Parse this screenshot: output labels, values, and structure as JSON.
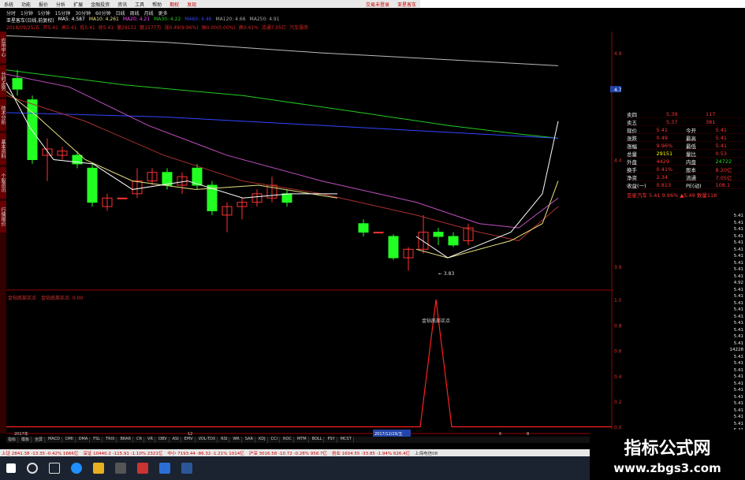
{
  "menubar": {
    "items": [
      "系统",
      "功能",
      "报价",
      "分析",
      "扩展",
      "金融投资",
      "资讯",
      "工具",
      "帮助"
    ],
    "badges": [
      "期权",
      "发现"
    ],
    "right": [
      "交易未登录",
      "亚星客车"
    ]
  },
  "periods": [
    "分时",
    "1分钟",
    "5分钟",
    "15分钟",
    "30分钟",
    "60分钟",
    "日线",
    "周线",
    "月线",
    "更多"
  ],
  "titlebar": {
    "stock": "亚星客车(日线,前复权)",
    "ma": [
      "MA5: 4.587",
      "MA10: 4.261",
      "MA20: 4.21",
      "MA30: 4.22",
      "MA60: 4.46",
      "MA120: 4.66",
      "MA250: 4.91"
    ]
  },
  "infobar": {
    "items": [
      "2018/09/25/五",
      "开5.41",
      "高5.41",
      "低5.41",
      "收5.41",
      "量29151",
      "额1577万",
      "涨0.49(9.96%)",
      "振0.00(0.00%)",
      "换0.41%",
      "流通7.05亿",
      "汽车服务"
    ]
  },
  "sidetabs": [
    "应用中心",
    "分时走势",
    "技术分析",
    "基本资料",
    "个股资讯",
    "行情报价"
  ],
  "price_labels": [
    "4.9",
    "4.73",
    "4.4",
    "3.9",
    "3.83"
  ],
  "panel": {
    "rows": [
      {
        "l": "卖四",
        "v": "5.39",
        "r": "117"
      },
      {
        "l": "卖五",
        "v": "5.37",
        "r": "381"
      },
      {
        "l": "现价",
        "v": "5.41",
        "m": "今开",
        "r": "5.41"
      },
      {
        "l": "涨跌",
        "v": "0.49",
        "m": "最高",
        "r": "5.41"
      },
      {
        "l": "涨幅",
        "v": "9.96%",
        "m": "最低",
        "r": "5.41"
      },
      {
        "l": "总量",
        "v": "29151",
        "m": "量比",
        "r": "0.53"
      },
      {
        "l": "外盘",
        "v": "4429",
        "m": "内盘",
        "r": "24722"
      },
      {
        "l": "换手",
        "v": "0.41%",
        "m": "股本",
        "r": "8.20亿"
      },
      {
        "l": "净资",
        "v": "2.34",
        "m": "流通",
        "r": "7.05亿"
      },
      {
        "l": "收益(一)",
        "v": "0.813",
        "m": "PE(动)",
        "r": "108.1"
      }
    ],
    "sub": "亚星汽车 5.41 9.96% ▲5.49 数量118"
  },
  "ticks": [
    "5.41",
    "5.41",
    "5.41",
    "5.41",
    "5.41",
    "5.41",
    "5.41",
    "5.41",
    "5.41",
    "5.41",
    "4.92",
    "5.41",
    "5.41",
    "5.41",
    "5.41",
    "5.41",
    "5.41",
    "5.41",
    "5.41",
    "5.41",
    "14228",
    "5.41",
    "5.41",
    "5.41",
    "5.41",
    "5.41",
    "5.41",
    "5.41",
    "5.41",
    "5.41",
    "5.41",
    "5.41",
    "5.41"
  ],
  "indicator": {
    "title": "金钻底部买点",
    "legend": "金钻底部买点: 0.00",
    "peak_label": "金钻底部买点",
    "yticks": [
      "1.00",
      "0.80",
      "0.60",
      "0.40",
      "0.20",
      "0.00"
    ]
  },
  "timeline": {
    "left": "2017年",
    "cursor": "2017/12/29/五",
    "marks": [
      "12",
      "6",
      "8"
    ]
  },
  "tabs": [
    "指标",
    "模板",
    "全屏",
    "MACD",
    "DMI",
    "DMA",
    "FSL",
    "TRIX",
    "BRAR",
    "CR",
    "VR",
    "OBV",
    "ASI",
    "EMV",
    "VOL-TDX",
    "RSI",
    "WR",
    "SAR",
    "KDJ",
    "CCI",
    "ROC",
    "MTM",
    "BOLL",
    "PSY",
    "MCST"
  ],
  "statusbar": [
    "上证 2841.38 -13.35 -0.42% 1666亿",
    "深证 10440.2 -115.91 -1.10% 2321亿",
    "中小 7193.44 -86.32 -1.21% 1014亿",
    "沪深 3016.58 -10.72 -0.28% 958.7亿",
    "创业 1604.55 -33.85 -1.94% 626.4亿",
    "上海电信08"
  ],
  "watermark": {
    "title": "指标公式网",
    "url": "www.zbgs3.com"
  },
  "colors": {
    "up": "#ff3232",
    "down": "#22ff22",
    "ma5": "#ffffff",
    "ma10": "#e8e080",
    "ma20": "#ff44ff",
    "ma30": "#22cc22",
    "ma60": "#3344ff",
    "ma120": "#aaaaaa"
  },
  "chart_data": {
    "type": "candlestick",
    "candles": [
      {
        "o": 4.78,
        "c": 4.73,
        "h": 4.82,
        "l": 4.7,
        "up": false
      },
      {
        "o": 4.68,
        "c": 4.4,
        "h": 4.7,
        "l": 4.38,
        "up": false
      },
      {
        "o": 4.42,
        "c": 4.45,
        "h": 4.5,
        "l": 4.3,
        "up": true
      },
      {
        "o": 4.42,
        "c": 4.44,
        "h": 4.46,
        "l": 4.4,
        "up": true
      },
      {
        "o": 4.42,
        "c": 4.38,
        "h": 4.44,
        "l": 4.36,
        "up": false
      },
      {
        "o": 4.36,
        "c": 4.2,
        "h": 4.38,
        "l": 4.18,
        "up": false
      },
      {
        "o": 4.18,
        "c": 4.22,
        "h": 4.24,
        "l": 4.16,
        "up": true
      },
      {
        "o": 4.22,
        "c": 4.22,
        "h": 4.22,
        "l": 4.22,
        "up": true
      },
      {
        "o": 4.24,
        "c": 4.3,
        "h": 4.36,
        "l": 4.22,
        "up": true
      },
      {
        "o": 4.3,
        "c": 4.34,
        "h": 4.36,
        "l": 4.28,
        "up": true
      },
      {
        "o": 4.34,
        "c": 4.28,
        "h": 4.36,
        "l": 4.26,
        "up": false
      },
      {
        "o": 4.28,
        "c": 4.32,
        "h": 4.34,
        "l": 4.24,
        "up": true
      },
      {
        "o": 4.36,
        "c": 4.28,
        "h": 4.38,
        "l": 4.26,
        "up": false
      },
      {
        "o": 4.28,
        "c": 4.16,
        "h": 4.3,
        "l": 4.14,
        "up": false
      },
      {
        "o": 4.14,
        "c": 4.18,
        "h": 4.2,
        "l": 4.06,
        "up": true
      },
      {
        "o": 4.18,
        "c": 4.2,
        "h": 4.22,
        "l": 4.12,
        "up": true
      },
      {
        "o": 4.2,
        "c": 4.24,
        "h": 4.26,
        "l": 4.18,
        "up": true
      },
      {
        "o": 4.22,
        "c": 4.28,
        "h": 4.32,
        "l": 4.2,
        "up": true
      },
      {
        "o": 4.24,
        "c": 4.2,
        "h": 4.26,
        "l": 4.18,
        "up": false
      },
      {
        "o": 4.1,
        "c": 4.06,
        "h": 4.12,
        "l": 4.04,
        "up": false
      },
      {
        "o": 4.06,
        "c": 4.06,
        "h": 4.06,
        "l": 4.06,
        "up": true
      },
      {
        "o": 4.04,
        "c": 3.94,
        "h": 4.05,
        "l": 3.93,
        "up": false
      },
      {
        "o": 3.94,
        "c": 3.98,
        "h": 3.99,
        "l": 3.88,
        "up": true
      },
      {
        "o": 3.98,
        "c": 4.06,
        "h": 4.14,
        "l": 3.96,
        "up": true
      },
      {
        "o": 4.06,
        "c": 4.04,
        "h": 4.08,
        "l": 4.0,
        "up": false
      },
      {
        "o": 4.04,
        "c": 4.0,
        "h": 4.06,
        "l": 3.99,
        "up": false
      },
      {
        "o": 4.02,
        "c": 4.08,
        "h": 4.1,
        "l": 4.0,
        "up": true
      }
    ],
    "ylim": [
      3.8,
      5.0
    ]
  }
}
